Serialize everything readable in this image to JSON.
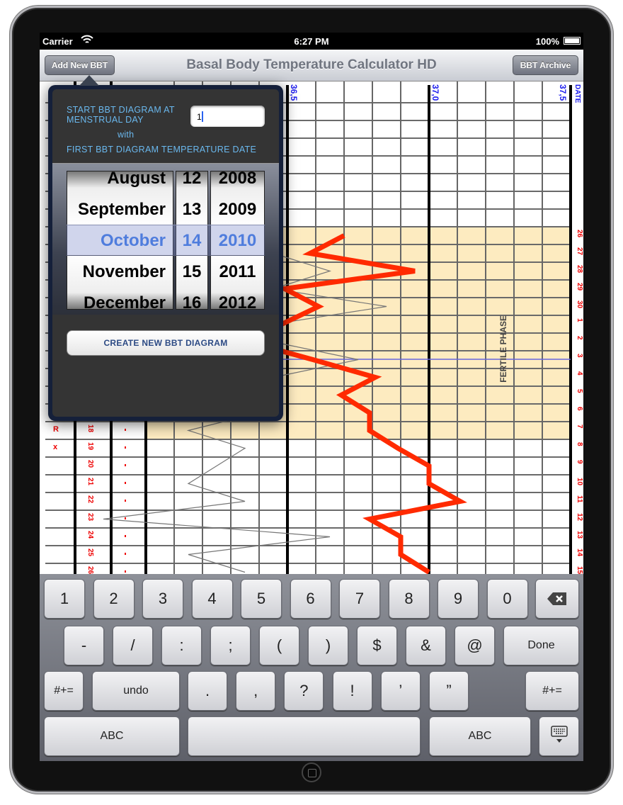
{
  "status": {
    "carrier": "Carrier",
    "time": "6:27 PM",
    "battery": "100%"
  },
  "nav": {
    "title": "Basal Body Temperature Calculator HD",
    "left_button": "Add New BBT",
    "right_button": "BBT Archive"
  },
  "chart": {
    "axis_labels": [
      "36,5",
      "37,0",
      "37,5"
    ],
    "date_header": "DATE",
    "fertile_label": "FERTILE PHASE",
    "fertile_color": "#fdebc0",
    "line_color": "#ff2a00",
    "rows": [
      {
        "day": "",
        "date": "",
        "mark": ""
      },
      {
        "day": "",
        "date": "",
        "mark": ""
      },
      {
        "day": "",
        "date": "",
        "mark": ""
      },
      {
        "day": "",
        "date": "",
        "mark": ""
      },
      {
        "day": "",
        "date": "",
        "mark": ""
      },
      {
        "day": "",
        "date": "",
        "mark": ""
      },
      {
        "day": "",
        "date": "",
        "mark": ""
      },
      {
        "day": "",
        "date": "26",
        "mark": ""
      },
      {
        "day": "",
        "date": "27",
        "mark": ""
      },
      {
        "day": "",
        "date": "28",
        "mark": ""
      },
      {
        "day": "",
        "date": "29",
        "mark": ""
      },
      {
        "day": "",
        "date": "30",
        "mark": ""
      },
      {
        "day": "",
        "date": "1",
        "mark": ""
      },
      {
        "day": "",
        "date": "2",
        "mark": ""
      },
      {
        "day": "",
        "date": "3",
        "mark": ""
      },
      {
        "day": "",
        "date": "4",
        "mark": ""
      },
      {
        "day": "",
        "date": "5",
        "mark": ""
      },
      {
        "day": "",
        "date": "6",
        "mark": ""
      },
      {
        "day": "18",
        "date": "7",
        "mark": "R"
      },
      {
        "day": "19",
        "date": "8",
        "mark": "x"
      },
      {
        "day": "20",
        "date": "9",
        "mark": ""
      },
      {
        "day": "21",
        "date": "10",
        "mark": ""
      },
      {
        "day": "22",
        "date": "11",
        "mark": ""
      },
      {
        "day": "23",
        "date": "12",
        "mark": ""
      },
      {
        "day": "24",
        "date": "13",
        "mark": ""
      },
      {
        "day": "25",
        "date": "14",
        "mark": ""
      },
      {
        "day": "26",
        "date": "15",
        "mark": ""
      }
    ],
    "fertile_rows": [
      7,
      18
    ],
    "temperatures": [
      null,
      null,
      null,
      null,
      null,
      null,
      null,
      36.7,
      36.58,
      36.95,
      36.49,
      36.61,
      36.48,
      36.36,
      36.59,
      36.81,
      36.69,
      36.79,
      36.79,
      36.89,
      37.0,
      37.0,
      37.11,
      36.79,
      36.9,
      36.9,
      37.0
    ],
    "secondary": [
      null,
      null,
      null,
      null,
      null,
      null,
      null,
      null,
      36.45,
      36.65,
      36.45,
      36.85,
      36.45,
      36.45,
      36.75,
      36.45,
      36.3,
      36.4,
      36.15,
      36.35,
      36.25,
      36.15,
      36.35,
      35.85,
      36.65,
      36.15,
      36.35
    ]
  },
  "popover": {
    "start_label": "START BBT DIAGRAM AT MENSTRUAL DAY",
    "with_label": "with",
    "first_date_label": "FIRST BBT DIAGRAM TEMPERATURE DATE",
    "day_value": "1",
    "months": [
      "August",
      "September",
      "October",
      "November",
      "December"
    ],
    "days": [
      "12",
      "13",
      "14",
      "15",
      "16"
    ],
    "years": [
      "2008",
      "2009",
      "2010",
      "2011",
      "2012"
    ],
    "selected_index": 2,
    "create_button": "CREATE NEW BBT DIAGRAM"
  },
  "keyboard": {
    "row1": [
      "1",
      "2",
      "3",
      "4",
      "5",
      "6",
      "7",
      "8",
      "9",
      "0"
    ],
    "row2": [
      "-",
      "/",
      ":",
      ";",
      "(",
      ")",
      "$",
      "&",
      "@"
    ],
    "done": "Done",
    "row3": [
      ".",
      ",",
      "?",
      "!",
      "’",
      "”"
    ],
    "shift_label": "#+=",
    "undo": "undo",
    "abc": "ABC"
  }
}
